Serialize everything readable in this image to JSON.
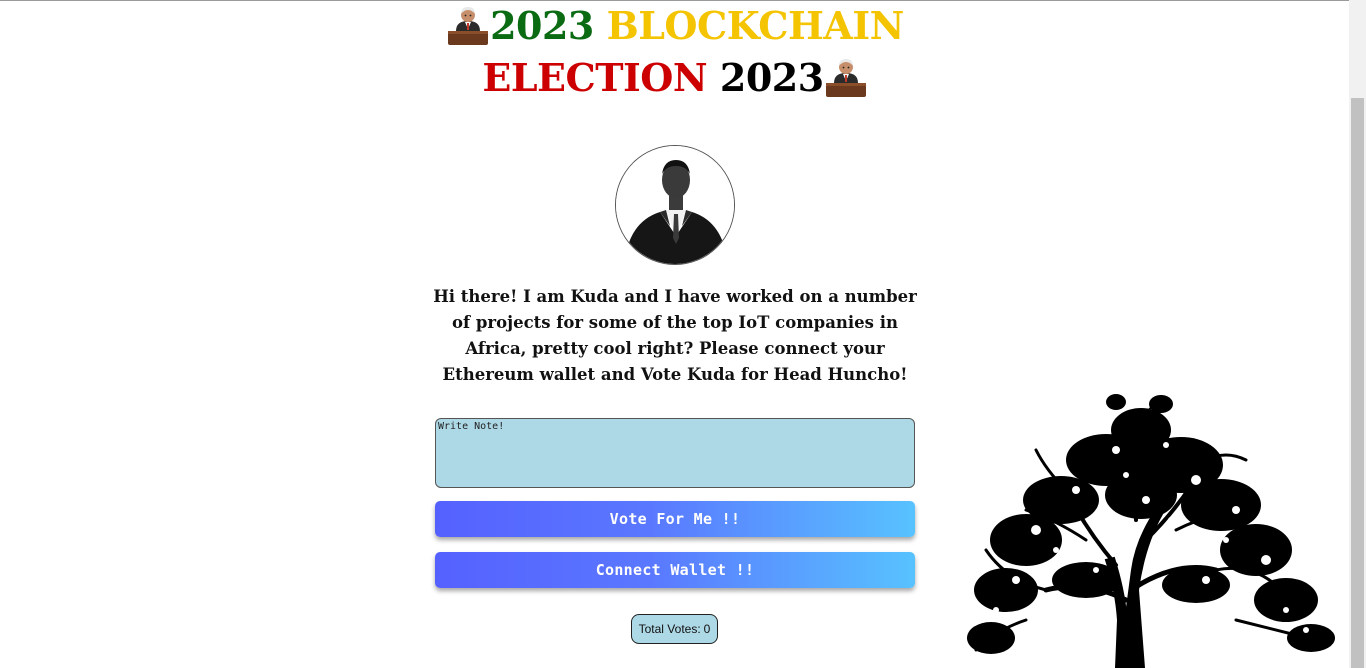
{
  "header": {
    "year_left": "2023",
    "word_blockchain": "BLOCKCHAIN",
    "word_election": "ELECTION",
    "year_right": "2023",
    "emoji_icon": "judge-emoji-icon"
  },
  "candidate": {
    "photo_icon": "candidate-photo",
    "bio": "Hi there! I am Kuda and I have worked on a number of projects for some of the top IoT companies in Africa, pretty cool right? Please connect your Ethereum wallet and Vote Kuda for Head Huncho!"
  },
  "note": {
    "placeholder": "Write Note!",
    "value": ""
  },
  "actions": {
    "vote_label": "Vote For Me !!",
    "connect_label": "Connect Wallet !!"
  },
  "votes": {
    "label": "Total Votes:",
    "count": "0"
  },
  "colors": {
    "green": "#0a6b12",
    "yellow": "#f5c400",
    "red": "#cc0000",
    "note_bg": "#add8e6",
    "button_start": "#5561ff",
    "button_end": "#58c2ff"
  }
}
